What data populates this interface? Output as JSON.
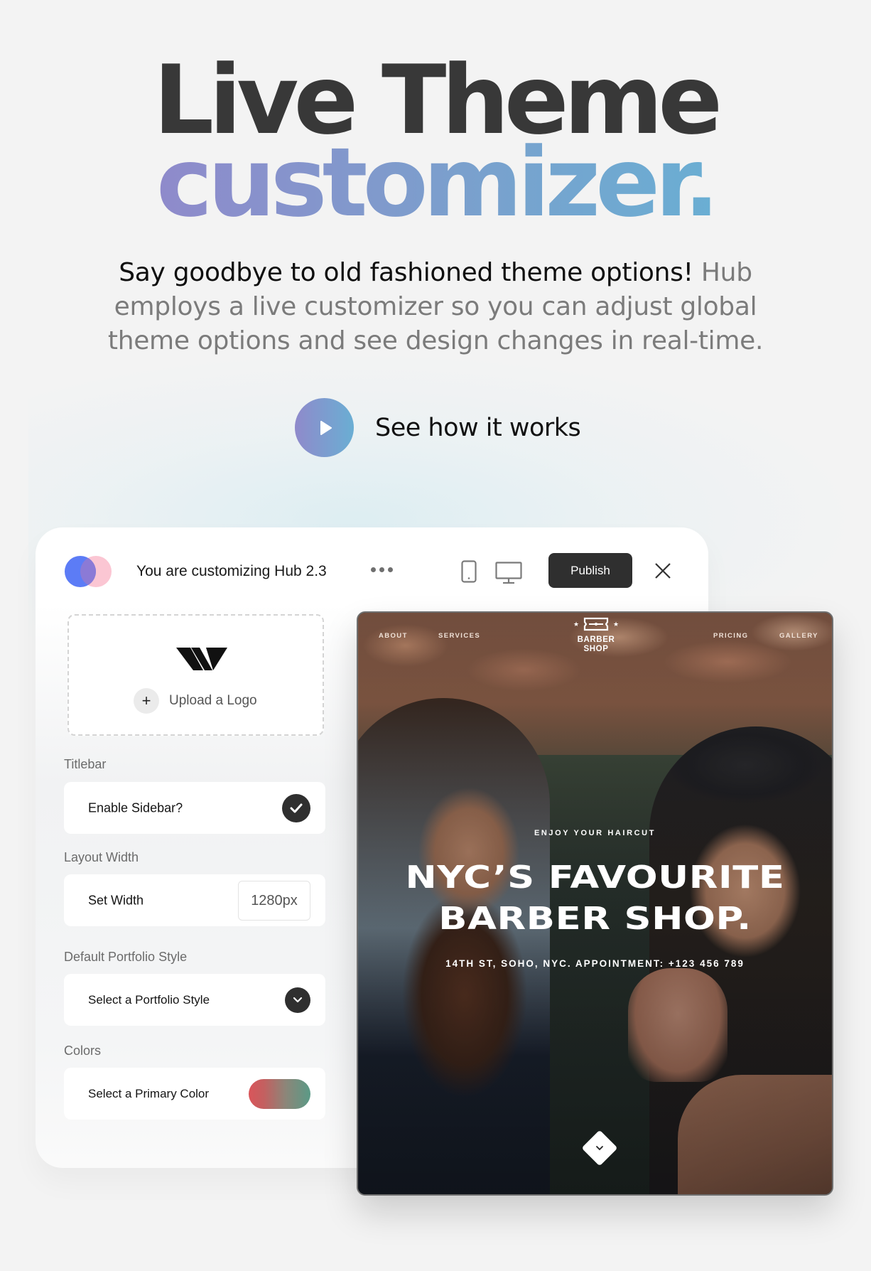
{
  "hero": {
    "title_line1": "Live Theme",
    "title_line2": "customizer.",
    "lead_strong": "Say goodbye to old fashioned theme options!",
    "lead_rest": " Hub employs a live customizer so you can adjust global theme options and see design changes in real-time.",
    "cta_label": "See how it works",
    "cta_icon": "play-icon",
    "gradient_colors": [
      "#8f8acb",
      "#6aaed3"
    ]
  },
  "customizer": {
    "title": "You are customizing Hub 2.3",
    "brand_colors": [
      "#5c7cf6",
      "#fbc6d3"
    ],
    "more_icon": "ellipsis-icon",
    "device_icons": [
      "mobile-icon",
      "desktop-icon"
    ],
    "publish_label": "Publish",
    "close_icon": "close-icon",
    "upload": {
      "logo_icon": "w-logo-icon",
      "label": "Upload a Logo",
      "icon": "plus-icon"
    },
    "sections": [
      {
        "label": "Titlebar",
        "control_label": "Enable Sidebar?",
        "type": "checkbox",
        "checked": true
      },
      {
        "label": "Layout Width",
        "control_label": "Set Width",
        "type": "input",
        "value": "1280px"
      },
      {
        "label": "Default Portfolio Style",
        "control_label": "Select a Portfolio Style",
        "type": "select"
      },
      {
        "label": "Colors",
        "control_label": "Select a Primary Color",
        "type": "color",
        "colors": [
          "#d9555a",
          "#5a9a86"
        ]
      }
    ]
  },
  "preview": {
    "nav_left": [
      "ABOUT",
      "SERVICES"
    ],
    "nav_right": [
      "PRICING",
      "GALLERY"
    ],
    "logo_line1": "BARBER",
    "logo_line2": "SHOP",
    "kicker": "ENJOY YOUR HAIRCUT",
    "headline_line1": "NYC’S FAVOURITE",
    "headline_line2": "BARBER SHOP.",
    "address": "14TH ST, SOHO, NYC. APPOINTMENT: +123 456 789",
    "scroll_icon": "chevron-down-icon"
  }
}
